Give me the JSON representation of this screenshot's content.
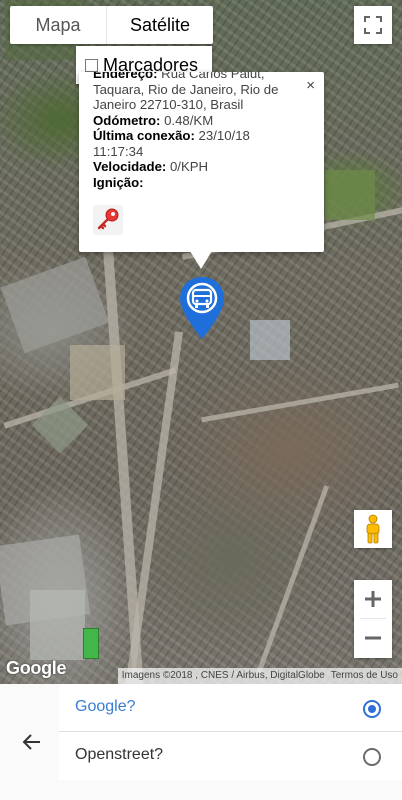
{
  "map": {
    "type_toggle": {
      "map_label": "Mapa",
      "satellite_label": "Satélite",
      "selected": "Satélite"
    },
    "markers_label": "Marcadores",
    "markers_checked": false,
    "google_logo": "Google",
    "attribution": {
      "imagery": "Imagens ©2018 , CNES / Airbus, DigitalGlobe",
      "terms": "Termos de Uso"
    }
  },
  "infowindow": {
    "address_label": "Endereço:",
    "address_value": " Rua Carlos Palut, Taquara, Rio de Janeiro, Rio de Janeiro 22710-310, Brasil",
    "odometer_label": "Odómetro:",
    "odometer_value": " 0.48/KM",
    "last_connection_label": "Última conexão:",
    "last_connection_value": " 23/10/18 11:17:34",
    "speed_label": "Velocidade:",
    "speed_value": " 0/KPH",
    "ignition_label": "Ignição:",
    "close_symbol": "×"
  },
  "map_provider_options": [
    {
      "label": "Google?",
      "selected": true
    },
    {
      "label": "Openstreet?",
      "selected": false
    }
  ],
  "colors": {
    "accent": "#2f6fd6",
    "marker_blue": "#1e6fd9",
    "ignition_red": "#e53935"
  }
}
